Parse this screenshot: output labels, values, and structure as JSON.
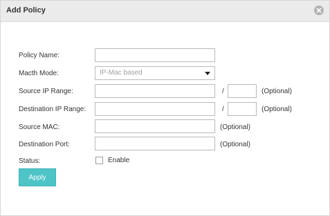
{
  "dialog": {
    "title": "Add Policy"
  },
  "form": {
    "policy_name": {
      "label": "Policy Name:",
      "value": ""
    },
    "match_mode": {
      "label": "Macth Mode:",
      "selected": "IP-Mac based"
    },
    "source_ip_range": {
      "label": "Source IP Range:",
      "value": "",
      "mask": "",
      "hint": "(Optional)"
    },
    "destination_ip_range": {
      "label": "Destination IP Range:",
      "value": "",
      "mask": "",
      "hint": "(Optional)"
    },
    "source_mac": {
      "label": "Source MAC:",
      "value": "",
      "hint": "(Optional)"
    },
    "destination_port": {
      "label": "Destination Port:",
      "value": "",
      "hint": "(Optional)"
    },
    "status": {
      "label": "Status:",
      "checkbox_label": "Enable",
      "checked": false
    },
    "slash": "/"
  },
  "actions": {
    "apply_label": "Apply"
  },
  "colors": {
    "accent": "#4ec4c7",
    "titlebar": "#ebebeb",
    "close_icon_bg": "#b3b3b3"
  },
  "icons": {
    "close": "close-circle-icon",
    "dropdown": "triangle-down-icon"
  }
}
